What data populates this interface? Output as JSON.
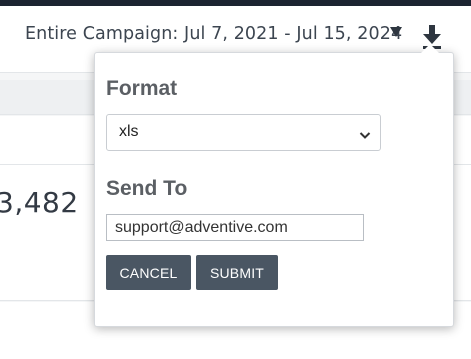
{
  "header": {
    "campaign_range": "Entire Campaign: Jul 7, 2021 - Jul 15, 2024",
    "range_dropdown_icon": "caret-down-icon",
    "download_icon": "download-icon"
  },
  "dashboard": {
    "stat_value": "3,482"
  },
  "export_popover": {
    "format_label": "Format",
    "format_selected": "xls",
    "format_chevron_icon": "chevron-down-icon",
    "send_to_label": "Send To",
    "email_value": "support@adventive.com",
    "cancel_label": "CANCEL",
    "submit_label": "SUBMIT"
  },
  "colors": {
    "topbar": "#1c2431",
    "button": "#4a5663",
    "label": "#5b5f64"
  }
}
